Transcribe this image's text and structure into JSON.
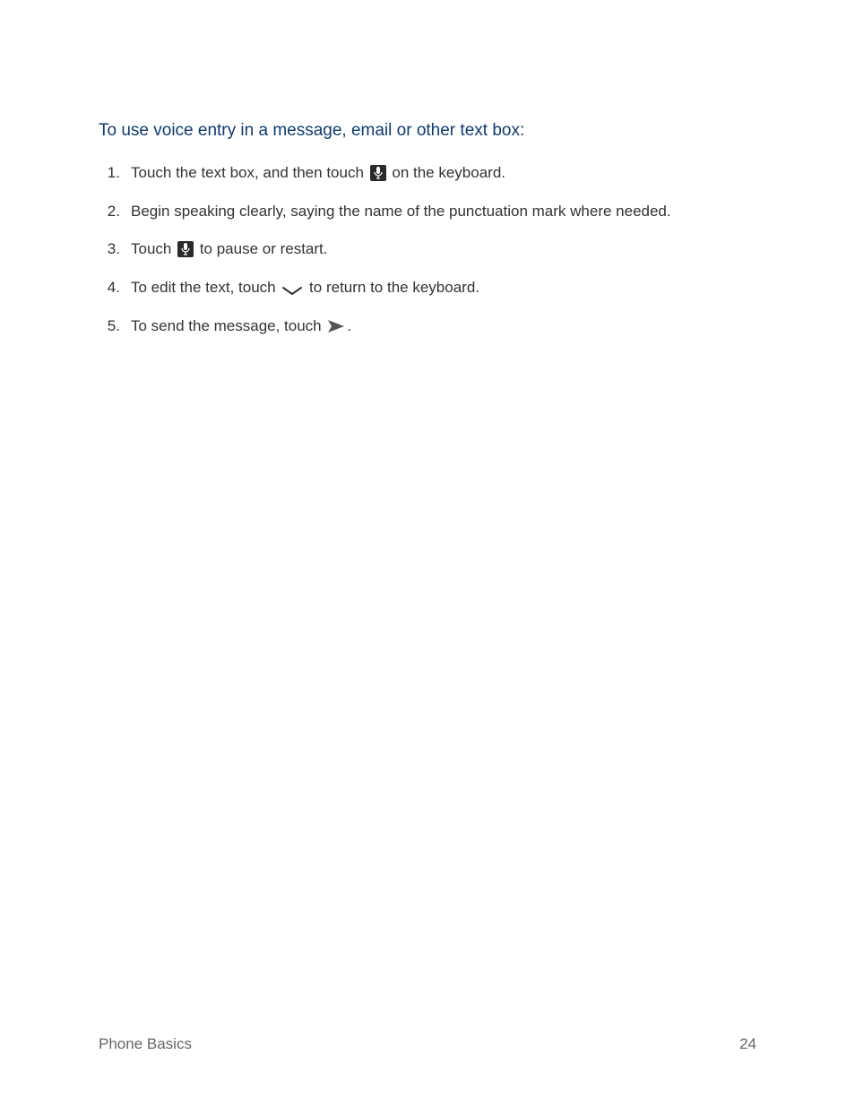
{
  "heading": "To use voice entry in a message, email or other text box:",
  "steps": {
    "s1a": "Touch the text box, and then touch ",
    "s1b": " on the keyboard.",
    "s2": "Begin speaking clearly, saying the name of the punctuation mark where needed.",
    "s3a": "Touch ",
    "s3b": " to pause or restart.",
    "s4a": "To edit the text, touch ",
    "s4b": " to return to the keyboard.",
    "s5a": "To send the message, touch ",
    "s5b": "."
  },
  "footer": {
    "section": "Phone Basics",
    "page": "24"
  }
}
